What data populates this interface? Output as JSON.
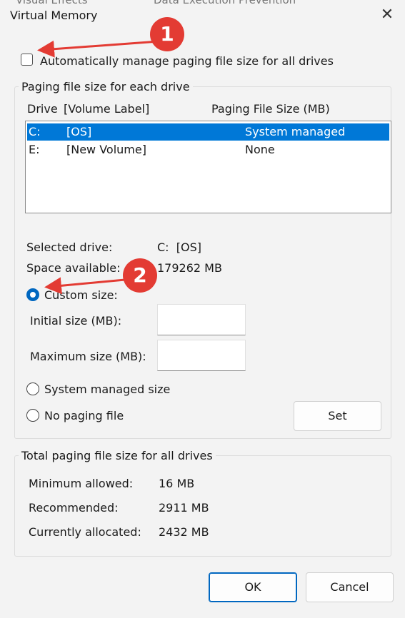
{
  "window": {
    "title": "Virtual Memory",
    "behind_tabs": [
      "Visual Effects",
      "Data Execution Prevention"
    ]
  },
  "auto_manage": {
    "label": "Automatically manage paging file size for all drives",
    "checked": false
  },
  "paging_group": {
    "legend": "Paging file size for each drive",
    "columns": {
      "drive": "Drive",
      "volume": "[Volume Label]",
      "size": "Paging File Size (MB)"
    },
    "rows": [
      {
        "drive": "C:",
        "label": "[OS]",
        "size": "System managed",
        "selected": true
      },
      {
        "drive": "E:",
        "label": "[New Volume]",
        "size": "None",
        "selected": false
      }
    ],
    "selected_drive_label": "Selected drive:",
    "selected_drive_value": "C:  [OS]",
    "space_label": "Space available:",
    "space_value": "179262 MB",
    "custom_size": "Custom size:",
    "initial_label": "Initial size (MB):",
    "initial_value": "",
    "maximum_label": "Maximum size (MB):",
    "maximum_value": "",
    "system_managed": "System managed size",
    "no_paging": "No paging file",
    "set_button": "Set",
    "selected_option": "custom"
  },
  "total_group": {
    "legend": "Total paging file size for all drives",
    "min_label": "Minimum allowed:",
    "min_value": "16 MB",
    "rec_label": "Recommended:",
    "rec_value": "2911 MB",
    "cur_label": "Currently allocated:",
    "cur_value": "2432 MB"
  },
  "buttons": {
    "ok": "OK",
    "cancel": "Cancel"
  },
  "annotations": [
    {
      "number": "1",
      "color": "#e33b33"
    },
    {
      "number": "2",
      "color": "#e33b33"
    }
  ]
}
